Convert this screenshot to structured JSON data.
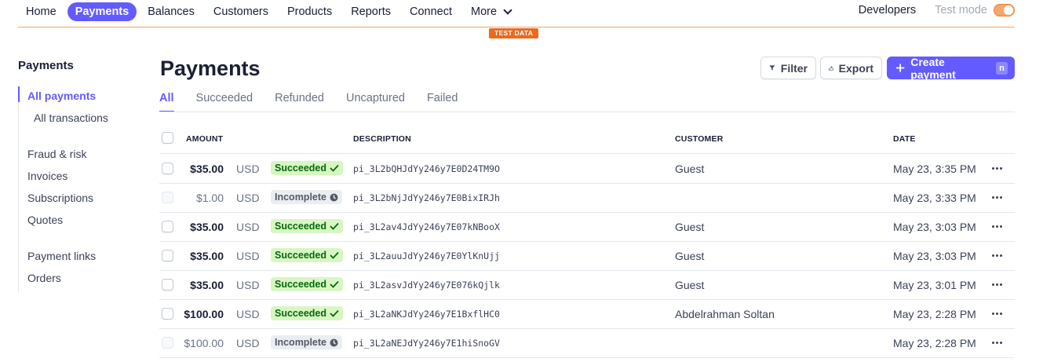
{
  "nav": {
    "items": [
      {
        "label": "Home",
        "active": false
      },
      {
        "label": "Payments",
        "active": true
      },
      {
        "label": "Balances",
        "active": false
      },
      {
        "label": "Customers",
        "active": false
      },
      {
        "label": "Products",
        "active": false
      },
      {
        "label": "Reports",
        "active": false
      },
      {
        "label": "Connect",
        "active": false
      }
    ],
    "more_label": "More",
    "developers_label": "Developers",
    "test_mode_label": "Test mode",
    "test_mode_on": true,
    "test_data_badge": "TEST DATA"
  },
  "sidebar": {
    "title": "Payments",
    "items": [
      {
        "label": "All payments",
        "active": true
      },
      {
        "label": "All transactions"
      },
      {
        "label": "Fraud & risk"
      },
      {
        "label": "Invoices"
      },
      {
        "label": "Subscriptions"
      },
      {
        "label": "Quotes"
      },
      {
        "label": "Payment links"
      },
      {
        "label": "Orders"
      }
    ]
  },
  "main": {
    "title": "Payments",
    "filter_label": "Filter",
    "export_label": "Export",
    "create_label": "Create payment",
    "create_shortcut": "n",
    "tabs": [
      "All",
      "Succeeded",
      "Refunded",
      "Uncaptured",
      "Failed"
    ],
    "active_tab": "All"
  },
  "table": {
    "columns": [
      "AMOUNT",
      "DESCRIPTION",
      "CUSTOMER",
      "DATE"
    ],
    "rows": [
      {
        "amount": "$35.00",
        "currency": "USD",
        "status": "Succeeded",
        "description": "pi_3L2bQHJdYy246y7E0D24TM9O",
        "customer": "Guest",
        "date": "May 23, 3:35 PM"
      },
      {
        "amount": "$1.00",
        "currency": "USD",
        "status": "Incomplete",
        "description": "pi_3L2bNjJdYy246y7E0BixIRJh",
        "customer": "",
        "date": "May 23, 3:33 PM"
      },
      {
        "amount": "$35.00",
        "currency": "USD",
        "status": "Succeeded",
        "description": "pi_3L2av4JdYy246y7E07kNBooX",
        "customer": "Guest",
        "date": "May 23, 3:03 PM"
      },
      {
        "amount": "$35.00",
        "currency": "USD",
        "status": "Succeeded",
        "description": "pi_3L2auuJdYy246y7E0YlKnUjj",
        "customer": "Guest",
        "date": "May 23, 3:03 PM"
      },
      {
        "amount": "$35.00",
        "currency": "USD",
        "status": "Succeeded",
        "description": "pi_3L2asvJdYy246y7E076kQjlk",
        "customer": "Guest",
        "date": "May 23, 3:01 PM"
      },
      {
        "amount": "$100.00",
        "currency": "USD",
        "status": "Succeeded",
        "description": "pi_3L2aNKJdYy246y7E1BxflHC0",
        "customer": "Abdelrahman Soltan",
        "date": "May 23, 2:28 PM"
      },
      {
        "amount": "$100.00",
        "currency": "USD",
        "status": "Incomplete",
        "description": "pi_3L2aNEJdYy246y7E1hiSnoGV",
        "customer": "",
        "date": "May 23, 2:28 PM"
      }
    ]
  },
  "colors": {
    "accent": "#635bff",
    "test_mode": "#ea6a1f",
    "success_bg": "#d7f7c2",
    "success_text": "#05690d"
  }
}
